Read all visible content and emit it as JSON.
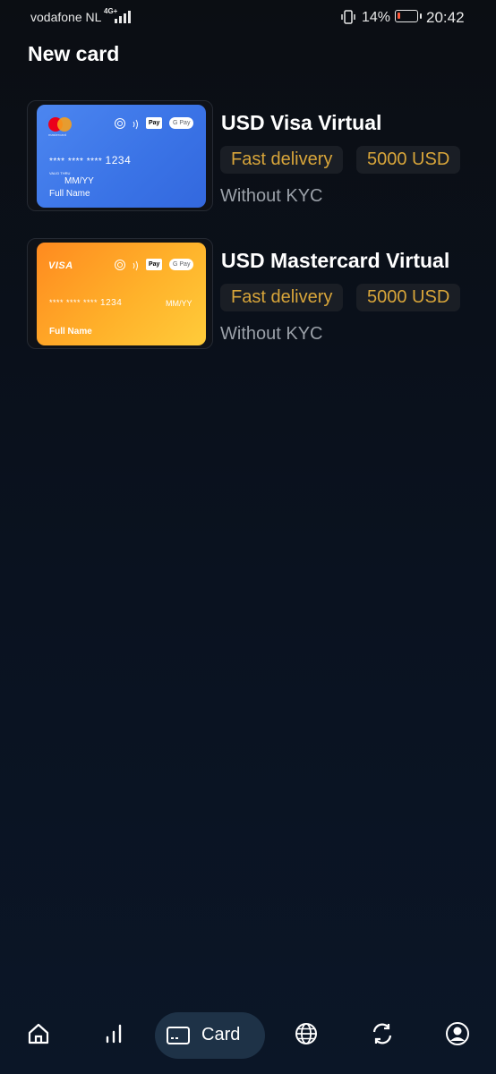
{
  "status_bar": {
    "carrier": "vodafone NL",
    "network": "4G+",
    "battery_percent": "14%",
    "time": "20:42"
  },
  "page": {
    "title": "New card"
  },
  "products": [
    {
      "title": "USD Visa Virtual",
      "tag_delivery": "Fast delivery",
      "tag_limit": "5000 USD",
      "kyc": "Without KYC",
      "card": {
        "brand_subtext": "mastercard",
        "apple_pay": "Pay",
        "google_pay": "G Pay",
        "number_masked": "**** **** ****",
        "number_last": "1234",
        "valid_thru": "VALID THRU",
        "expiry": "MM/YY",
        "holder": "Full Name"
      }
    },
    {
      "title": "USD Mastercard Virtual",
      "tag_delivery": "Fast delivery",
      "tag_limit": "5000 USD",
      "kyc": "Without KYC",
      "card": {
        "brand": "VISA",
        "apple_pay": "Pay",
        "google_pay": "G Pay",
        "number_masked": "**** **** ****",
        "number_last": "1234",
        "expiry": "MM/YY",
        "holder": "Full Name"
      }
    }
  ],
  "nav": {
    "items": [
      {
        "icon": "home-icon"
      },
      {
        "icon": "chart-icon"
      },
      {
        "icon": "card-icon",
        "label": "Card",
        "active": true
      },
      {
        "icon": "globe-icon"
      },
      {
        "icon": "exchange-icon"
      },
      {
        "icon": "profile-icon"
      }
    ]
  },
  "colors": {
    "accent_tag_text": "#d8a53a",
    "card_blue": "#3f78ea",
    "card_orange": "#ffa826",
    "nav_active_bg": "#1e3247"
  }
}
